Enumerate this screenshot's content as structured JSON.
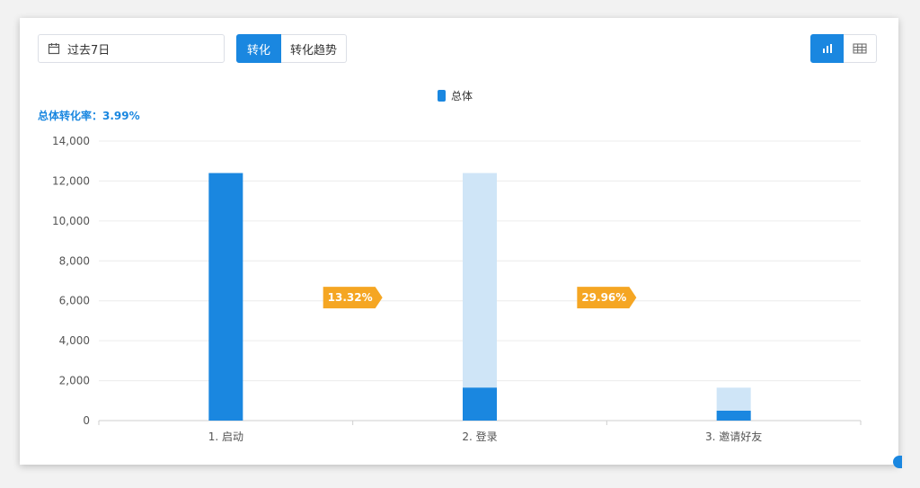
{
  "toolbar": {
    "date_range": "过去7日",
    "tab_conversion": "转化",
    "tab_trend": "转化趋势"
  },
  "legend": {
    "label": "总体"
  },
  "summary": {
    "overall_rate": "总体转化率：3.99%"
  },
  "colors": {
    "accent": "#1a87e0",
    "bar_light": "#cfe5f7",
    "badge": "#f5a623",
    "grid": "#ececec"
  },
  "chart_data": {
    "type": "bar",
    "categories": [
      "1. 启动",
      "2. 登录",
      "3. 邀请好友"
    ],
    "series": [
      {
        "name": "总体",
        "values": [
          12400,
          1650,
          495
        ]
      }
    ],
    "previous_step_values": [
      null,
      12400,
      1650
    ],
    "conversion_labels": [
      "13.32%",
      "29.96%"
    ],
    "y_ticks": [
      "0",
      "2,000",
      "4,000",
      "6,000",
      "8,000",
      "10,000",
      "12,000",
      "14,000"
    ],
    "ylim": [
      0,
      14000
    ],
    "grid": true,
    "legend_position": "top-center"
  }
}
